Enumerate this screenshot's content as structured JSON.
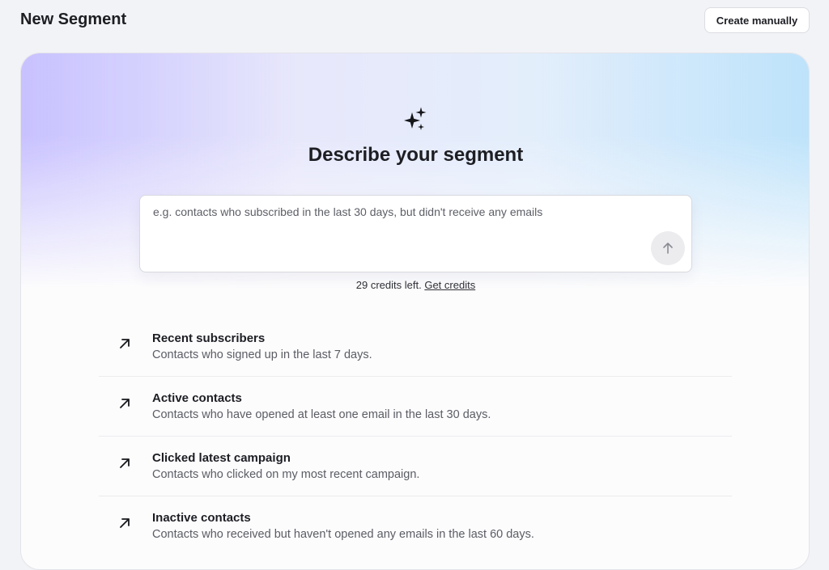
{
  "header": {
    "title": "New Segment",
    "create_manually_label": "Create manually"
  },
  "hero": {
    "icon": "sparkles-icon",
    "heading": "Describe your segment"
  },
  "prompt": {
    "value": "",
    "placeholder": "e.g. contacts who subscribed in the last 30 days, but didn't receive any emails",
    "send_icon": "arrow-up-icon"
  },
  "credits": {
    "text": "29 credits left.",
    "link_label": "Get credits"
  },
  "suggestions": [
    {
      "title": "Recent subscribers",
      "description": "Contacts who signed up in the last 7 days."
    },
    {
      "title": "Active contacts",
      "description": "Contacts who have opened at least one email in the last 30 days."
    },
    {
      "title": "Clicked latest campaign",
      "description": "Contacts who clicked on my most recent campaign."
    },
    {
      "title": "Inactive contacts",
      "description": "Contacts who received but haven't opened any emails in the last 60 days."
    }
  ],
  "colors": {
    "background": "#f2f3f6",
    "gradient_left": "#beb6ff",
    "gradient_right": "#bae1fa",
    "text_primary": "#1d1e23",
    "text_secondary": "#5b5d64"
  }
}
